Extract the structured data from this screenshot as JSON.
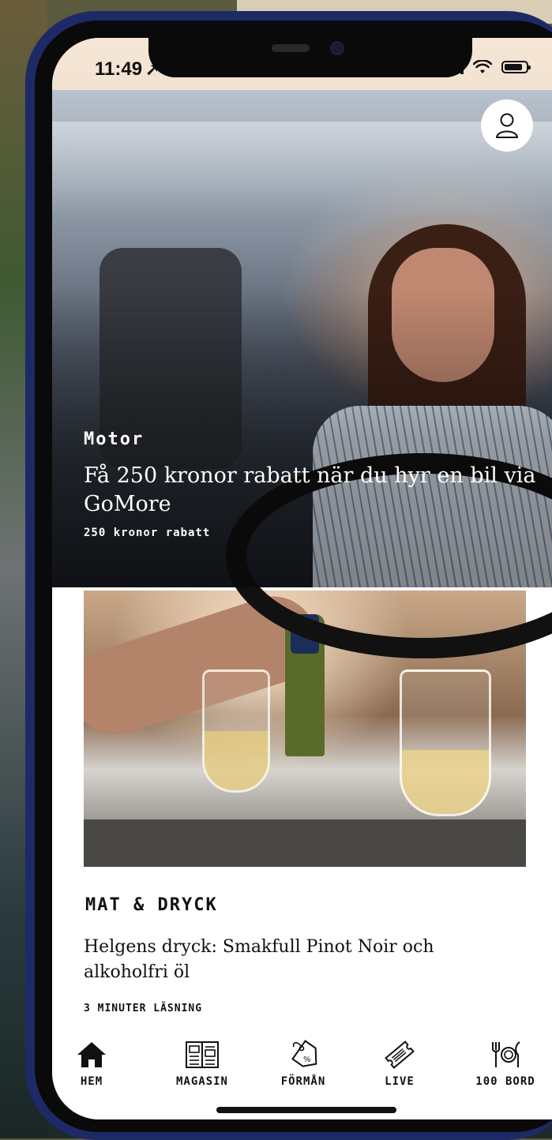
{
  "status_bar": {
    "time": "11:49",
    "location_arrow": "➚"
  },
  "profile": {
    "icon": "person-icon"
  },
  "hero": {
    "category": "Motor",
    "title": "Få 250 kronor rabatt när du hyr en bil via GoMore",
    "subtitle": "250 kronor rabatt"
  },
  "article": {
    "category": "MAT & DRYCK",
    "title": "Helgens dryck: Smakfull Pinot Noir och alkoholfri öl",
    "meta": "3 MINUTER LÄSNING"
  },
  "tabbar": {
    "items": [
      {
        "label": "HEM",
        "icon": "home-icon"
      },
      {
        "label": "MAGASIN",
        "icon": "magazine-icon"
      },
      {
        "label": "FÖRMÅN",
        "icon": "tag-icon"
      },
      {
        "label": "LIVE",
        "icon": "ticket-icon"
      },
      {
        "label": "100 BORD",
        "icon": "cutlery-icon"
      }
    ]
  }
}
